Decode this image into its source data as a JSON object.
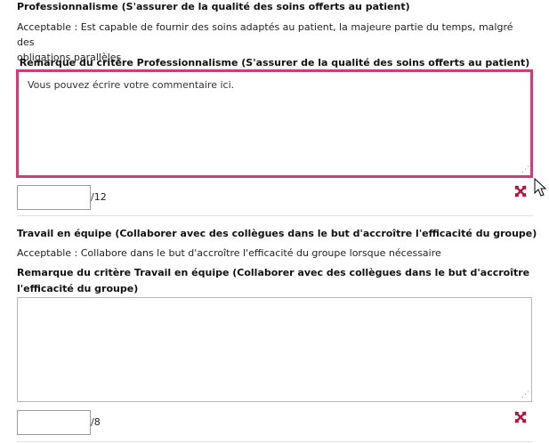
{
  "criteria": [
    {
      "title": "Professionnalisme (S'assurer de la qualité des soins offerts au patient)",
      "level_text_line1": "Acceptable : Est capable de fournir des soins adaptés au patient, la majeure partie du temps, malgré des",
      "level_text_line2": "obligations parallèles",
      "remark_label": "Remarque du critère Professionnalisme (S'assurer de la qualité des soins offerts au patient)",
      "comment_value": "Vous pouvez écrire votre commentaire ici.",
      "score_value": "",
      "score_max": "/12",
      "clear_icon": "red-x-arrows-icon"
    },
    {
      "title": "Travail en équipe (Collaborer avec des collègues dans le but d'accroître l'efficacité du groupe)",
      "level_text": "Acceptable : Collabore dans le but d'accroître l'efficacité du groupe lorsque nécessaire",
      "remark_label_line1": "Remarque du critère Travail en équipe (Collaborer avec des collègues dans le but d'accroître",
      "remark_label_line2": "l'efficacité du groupe)",
      "comment_value": "",
      "score_value": "",
      "score_max": "/8",
      "clear_icon": "red-x-arrows-icon"
    }
  ],
  "colors": {
    "focus_border": "#c94078",
    "clear_icon": "#b5163f"
  }
}
